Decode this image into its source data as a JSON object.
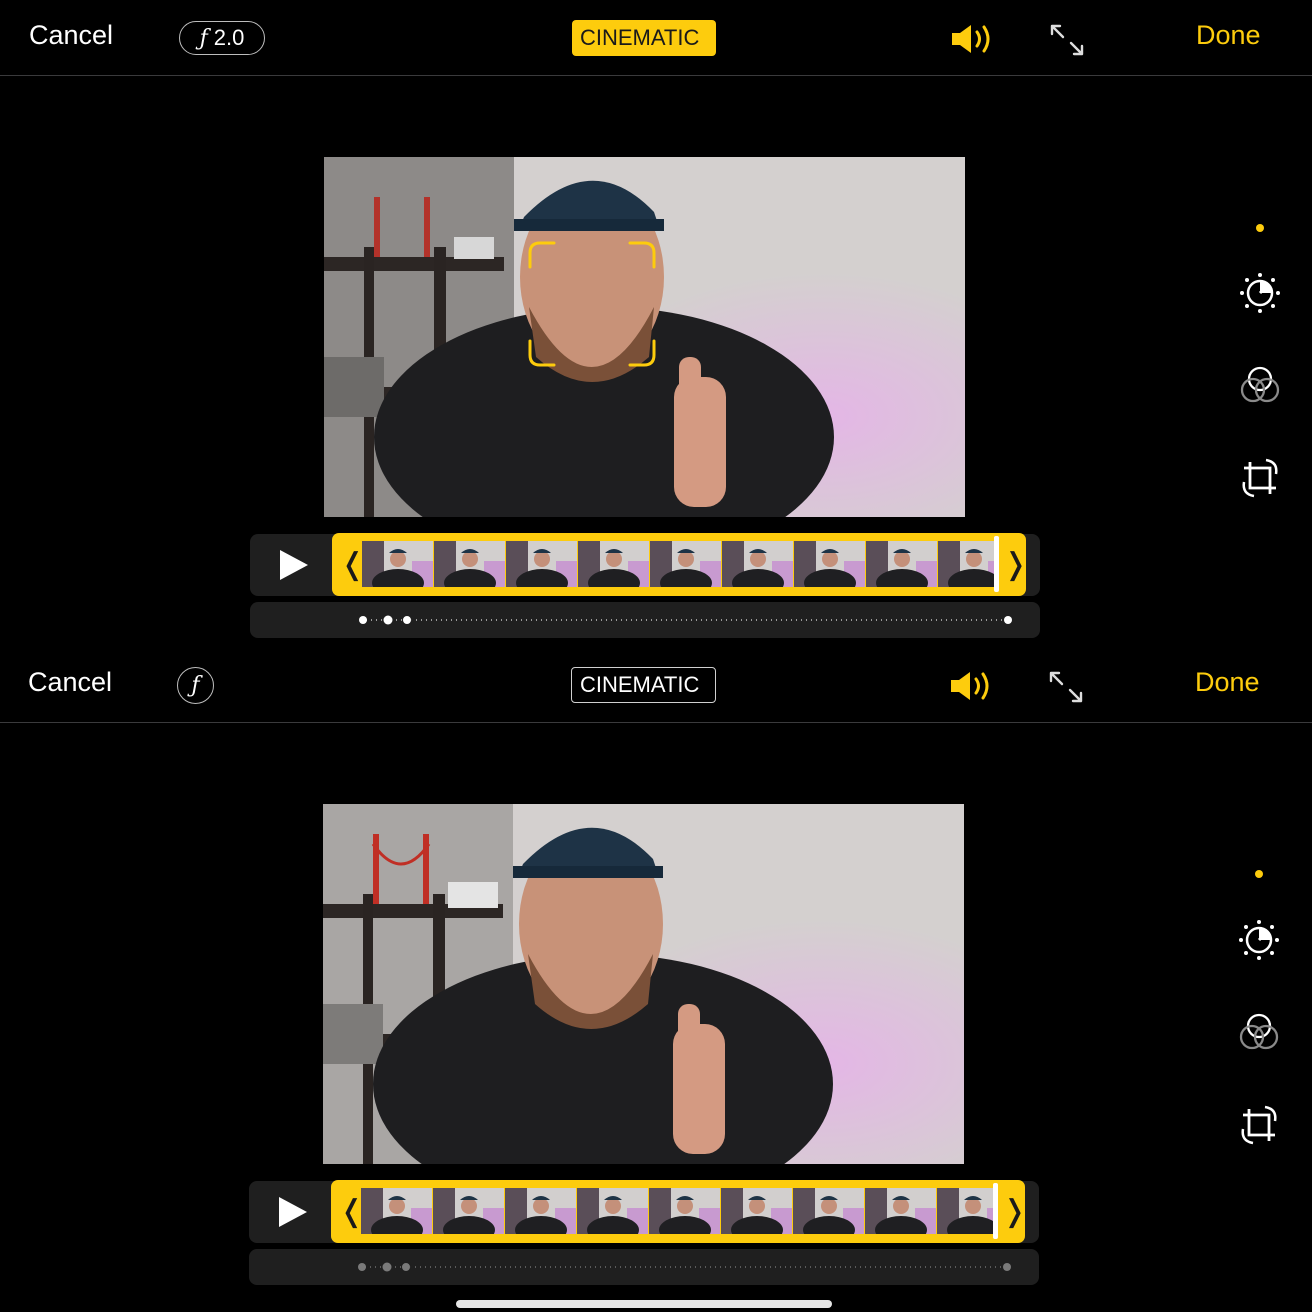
{
  "panels": [
    {
      "cancel_label": "Cancel",
      "aperture_label": "ƒ 2.0",
      "aperture_symbol": "ƒ",
      "aperture_value": "2.0",
      "cinematic_label": "CINEMATIC",
      "cinematic_active": true,
      "done_label": "Done",
      "speaker_icon": "speaker-wave-icon",
      "expand_icon": "expand-arrows-icon",
      "focus_box_visible": true,
      "play_icon": "play-icon",
      "focus_track_active": true
    },
    {
      "cancel_label": "Cancel",
      "aperture_symbol": "ƒ",
      "cinematic_label": "CINEMATIC",
      "cinematic_active": false,
      "done_label": "Done",
      "speaker_icon": "speaker-wave-icon",
      "expand_icon": "expand-arrows-icon",
      "focus_box_visible": false,
      "play_icon": "play-icon",
      "focus_track_active": false
    }
  ],
  "sidebar_icons": [
    "adjust-dial-icon",
    "filters-circles-icon",
    "crop-rotate-icon"
  ],
  "colors": {
    "accent": "#fdcc0d",
    "background": "#000000",
    "track": "#1f1f1f"
  }
}
